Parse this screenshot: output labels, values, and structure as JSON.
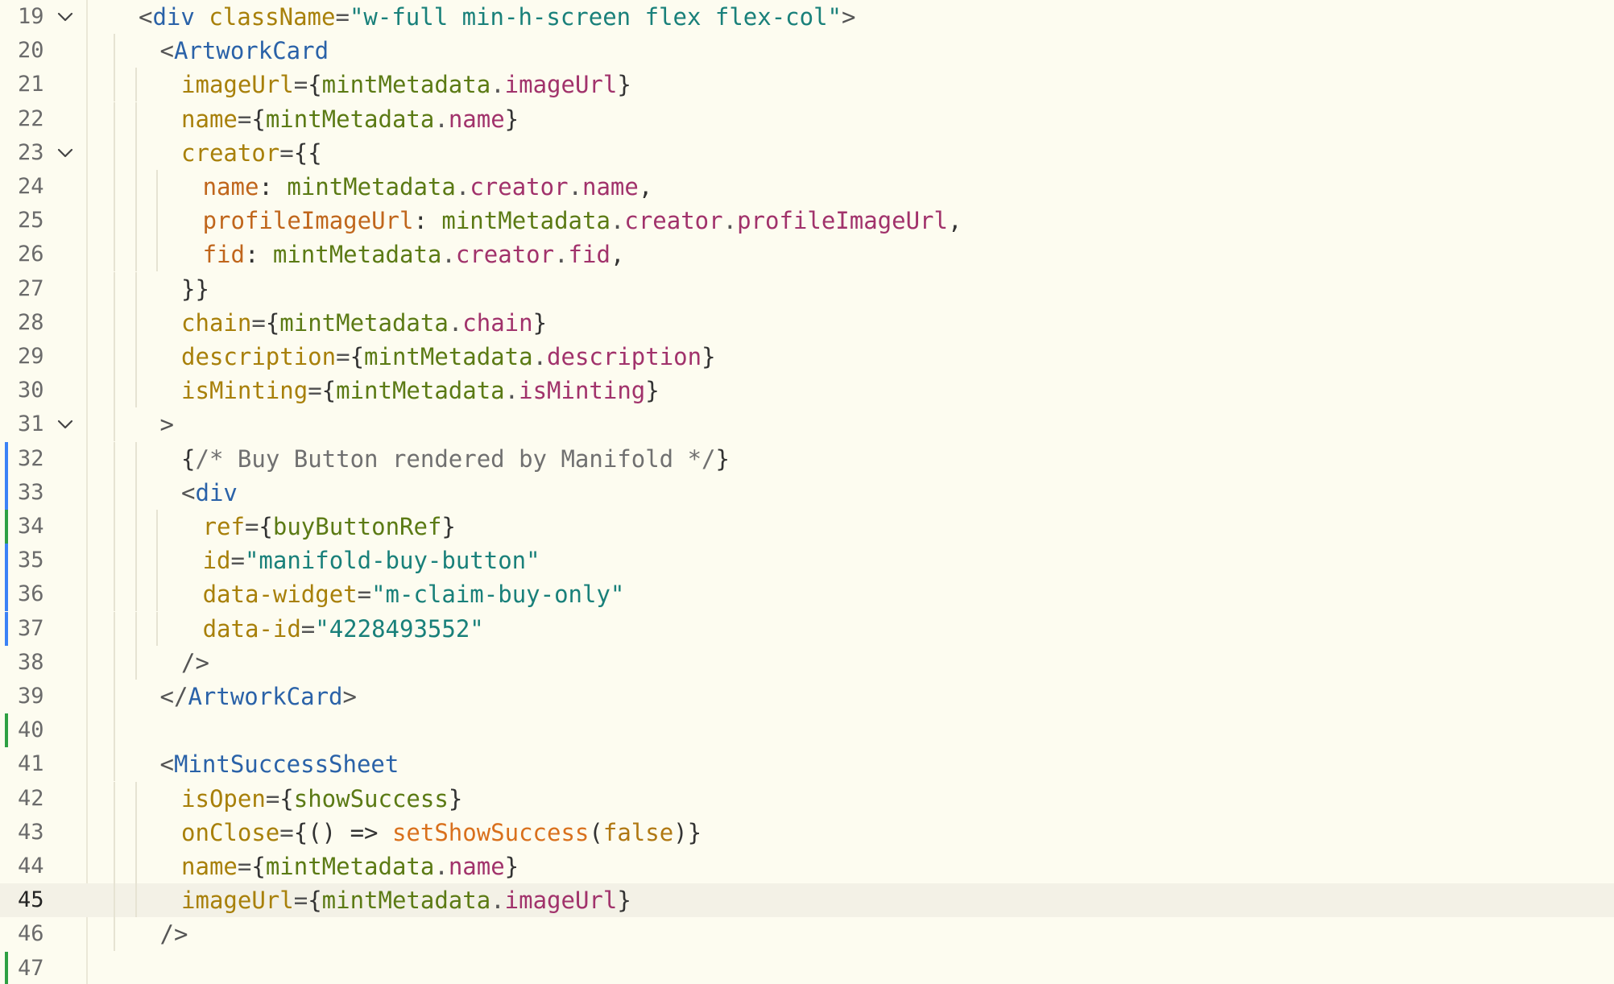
{
  "editor": {
    "current_line": "45",
    "colors": {
      "background": "#fdfcf0",
      "tag": "#2a62a8",
      "attribute": "#a8800a",
      "string": "#19807a",
      "identifier": "#5b7a14",
      "property": "#a1326b",
      "key": "#c0661c",
      "function": "#d9701c",
      "comment": "#707070",
      "diff_added": "#2ea043",
      "diff_modified": "#3b82f6"
    },
    "lines": [
      {
        "num": "19",
        "fold": true,
        "diff": "",
        "indent": 0,
        "tokens": [
          {
            "t": "<",
            "c": "punc"
          },
          {
            "t": "div",
            "c": "tag"
          },
          {
            "t": " ",
            "c": "punc"
          },
          {
            "t": "className",
            "c": "attr"
          },
          {
            "t": "=",
            "c": "punc"
          },
          {
            "t": "\"w-full min-h-screen flex flex-col\"",
            "c": "str"
          },
          {
            "t": ">",
            "c": "punc"
          }
        ]
      },
      {
        "num": "20",
        "fold": false,
        "diff": "",
        "indent": 1,
        "tokens": [
          {
            "t": "<",
            "c": "punc"
          },
          {
            "t": "ArtworkCard",
            "c": "tag"
          }
        ]
      },
      {
        "num": "21",
        "fold": false,
        "diff": "",
        "indent": 2,
        "tokens": [
          {
            "t": "imageUrl",
            "c": "attr"
          },
          {
            "t": "=",
            "c": "punc"
          },
          {
            "t": "{",
            "c": "brace"
          },
          {
            "t": "mintMetadata",
            "c": "ident"
          },
          {
            "t": ".",
            "c": "punc"
          },
          {
            "t": "imageUrl",
            "c": "prop"
          },
          {
            "t": "}",
            "c": "brace"
          }
        ]
      },
      {
        "num": "22",
        "fold": false,
        "diff": "",
        "indent": 2,
        "tokens": [
          {
            "t": "name",
            "c": "attr"
          },
          {
            "t": "=",
            "c": "punc"
          },
          {
            "t": "{",
            "c": "brace"
          },
          {
            "t": "mintMetadata",
            "c": "ident"
          },
          {
            "t": ".",
            "c": "punc"
          },
          {
            "t": "name",
            "c": "prop"
          },
          {
            "t": "}",
            "c": "brace"
          }
        ]
      },
      {
        "num": "23",
        "fold": true,
        "diff": "",
        "indent": 2,
        "tokens": [
          {
            "t": "creator",
            "c": "attr"
          },
          {
            "t": "=",
            "c": "punc"
          },
          {
            "t": "{{",
            "c": "brace"
          }
        ]
      },
      {
        "num": "24",
        "fold": false,
        "diff": "",
        "indent": 3,
        "tokens": [
          {
            "t": "name",
            "c": "key"
          },
          {
            "t": ": ",
            "c": "brace"
          },
          {
            "t": "mintMetadata",
            "c": "ident"
          },
          {
            "t": ".",
            "c": "punc"
          },
          {
            "t": "creator",
            "c": "prop"
          },
          {
            "t": ".",
            "c": "punc"
          },
          {
            "t": "name",
            "c": "prop"
          },
          {
            "t": ",",
            "c": "brace"
          }
        ]
      },
      {
        "num": "25",
        "fold": false,
        "diff": "",
        "indent": 3,
        "tokens": [
          {
            "t": "profileImageUrl",
            "c": "key"
          },
          {
            "t": ": ",
            "c": "brace"
          },
          {
            "t": "mintMetadata",
            "c": "ident"
          },
          {
            "t": ".",
            "c": "punc"
          },
          {
            "t": "creator",
            "c": "prop"
          },
          {
            "t": ".",
            "c": "punc"
          },
          {
            "t": "profileImageUrl",
            "c": "prop"
          },
          {
            "t": ",",
            "c": "brace"
          }
        ]
      },
      {
        "num": "26",
        "fold": false,
        "diff": "",
        "indent": 3,
        "tokens": [
          {
            "t": "fid",
            "c": "key"
          },
          {
            "t": ": ",
            "c": "brace"
          },
          {
            "t": "mintMetadata",
            "c": "ident"
          },
          {
            "t": ".",
            "c": "punc"
          },
          {
            "t": "creator",
            "c": "prop"
          },
          {
            "t": ".",
            "c": "punc"
          },
          {
            "t": "fid",
            "c": "prop"
          },
          {
            "t": ",",
            "c": "brace"
          }
        ]
      },
      {
        "num": "27",
        "fold": false,
        "diff": "",
        "indent": 2,
        "tokens": [
          {
            "t": "}}",
            "c": "brace"
          }
        ]
      },
      {
        "num": "28",
        "fold": false,
        "diff": "",
        "indent": 2,
        "tokens": [
          {
            "t": "chain",
            "c": "attr"
          },
          {
            "t": "=",
            "c": "punc"
          },
          {
            "t": "{",
            "c": "brace"
          },
          {
            "t": "mintMetadata",
            "c": "ident"
          },
          {
            "t": ".",
            "c": "punc"
          },
          {
            "t": "chain",
            "c": "prop"
          },
          {
            "t": "}",
            "c": "brace"
          }
        ]
      },
      {
        "num": "29",
        "fold": false,
        "diff": "",
        "indent": 2,
        "tokens": [
          {
            "t": "description",
            "c": "attr"
          },
          {
            "t": "=",
            "c": "punc"
          },
          {
            "t": "{",
            "c": "brace"
          },
          {
            "t": "mintMetadata",
            "c": "ident"
          },
          {
            "t": ".",
            "c": "punc"
          },
          {
            "t": "description",
            "c": "prop"
          },
          {
            "t": "}",
            "c": "brace"
          }
        ]
      },
      {
        "num": "30",
        "fold": false,
        "diff": "",
        "indent": 2,
        "tokens": [
          {
            "t": "isMinting",
            "c": "attr"
          },
          {
            "t": "=",
            "c": "punc"
          },
          {
            "t": "{",
            "c": "brace"
          },
          {
            "t": "mintMetadata",
            "c": "ident"
          },
          {
            "t": ".",
            "c": "punc"
          },
          {
            "t": "isMinting",
            "c": "prop"
          },
          {
            "t": "}",
            "c": "brace"
          }
        ]
      },
      {
        "num": "31",
        "fold": true,
        "diff": "",
        "indent": 1,
        "tokens": [
          {
            "t": ">",
            "c": "punc"
          }
        ]
      },
      {
        "num": "32",
        "fold": false,
        "diff": "modified",
        "indent": 2,
        "tokens": [
          {
            "t": "{",
            "c": "brace"
          },
          {
            "t": "/* Buy Button rendered by Manifold */",
            "c": "comment"
          },
          {
            "t": "}",
            "c": "brace"
          }
        ]
      },
      {
        "num": "33",
        "fold": false,
        "diff": "modified",
        "indent": 2,
        "tokens": [
          {
            "t": "<",
            "c": "punc"
          },
          {
            "t": "div",
            "c": "tag"
          }
        ]
      },
      {
        "num": "34",
        "fold": false,
        "diff": "added",
        "indent": 3,
        "tokens": [
          {
            "t": "ref",
            "c": "attr"
          },
          {
            "t": "=",
            "c": "punc"
          },
          {
            "t": "{",
            "c": "brace"
          },
          {
            "t": "buyButtonRef",
            "c": "ident"
          },
          {
            "t": "}",
            "c": "brace"
          }
        ]
      },
      {
        "num": "35",
        "fold": false,
        "diff": "modified",
        "indent": 3,
        "tokens": [
          {
            "t": "id",
            "c": "attr"
          },
          {
            "t": "=",
            "c": "punc"
          },
          {
            "t": "\"manifold-buy-button\"",
            "c": "str"
          }
        ]
      },
      {
        "num": "36",
        "fold": false,
        "diff": "modified",
        "indent": 3,
        "tokens": [
          {
            "t": "data-widget",
            "c": "attr"
          },
          {
            "t": "=",
            "c": "punc"
          },
          {
            "t": "\"m-claim-buy-only\"",
            "c": "str"
          }
        ]
      },
      {
        "num": "37",
        "fold": false,
        "diff": "modified",
        "indent": 3,
        "tokens": [
          {
            "t": "data-id",
            "c": "attr"
          },
          {
            "t": "=",
            "c": "punc"
          },
          {
            "t": "\"4228493552\"",
            "c": "str"
          }
        ]
      },
      {
        "num": "38",
        "fold": false,
        "diff": "",
        "indent": 2,
        "tokens": [
          {
            "t": "/>",
            "c": "punc"
          }
        ]
      },
      {
        "num": "39",
        "fold": false,
        "diff": "",
        "indent": 1,
        "tokens": [
          {
            "t": "</",
            "c": "punc"
          },
          {
            "t": "ArtworkCard",
            "c": "tag"
          },
          {
            "t": ">",
            "c": "punc"
          }
        ]
      },
      {
        "num": "40",
        "fold": false,
        "diff": "added",
        "indent": 1,
        "tokens": []
      },
      {
        "num": "41",
        "fold": false,
        "diff": "",
        "indent": 1,
        "tokens": [
          {
            "t": "<",
            "c": "punc"
          },
          {
            "t": "MintSuccessSheet",
            "c": "tag"
          }
        ]
      },
      {
        "num": "42",
        "fold": false,
        "diff": "",
        "indent": 2,
        "tokens": [
          {
            "t": "isOpen",
            "c": "attr"
          },
          {
            "t": "=",
            "c": "punc"
          },
          {
            "t": "{",
            "c": "brace"
          },
          {
            "t": "showSuccess",
            "c": "ident"
          },
          {
            "t": "}",
            "c": "brace"
          }
        ]
      },
      {
        "num": "43",
        "fold": false,
        "diff": "",
        "indent": 2,
        "tokens": [
          {
            "t": "onClose",
            "c": "attr"
          },
          {
            "t": "=",
            "c": "punc"
          },
          {
            "t": "{() => ",
            "c": "brace"
          },
          {
            "t": "setShowSuccess",
            "c": "fn"
          },
          {
            "t": "(",
            "c": "brace"
          },
          {
            "t": "false",
            "c": "bool"
          },
          {
            "t": ")}",
            "c": "brace"
          }
        ]
      },
      {
        "num": "44",
        "fold": false,
        "diff": "",
        "indent": 2,
        "tokens": [
          {
            "t": "name",
            "c": "attr"
          },
          {
            "t": "=",
            "c": "punc"
          },
          {
            "t": "{",
            "c": "brace"
          },
          {
            "t": "mintMetadata",
            "c": "ident"
          },
          {
            "t": ".",
            "c": "punc"
          },
          {
            "t": "name",
            "c": "prop"
          },
          {
            "t": "}",
            "c": "brace"
          }
        ]
      },
      {
        "num": "45",
        "fold": false,
        "diff": "",
        "indent": 2,
        "tokens": [
          {
            "t": "imageUrl",
            "c": "attr"
          },
          {
            "t": "=",
            "c": "punc"
          },
          {
            "t": "{",
            "c": "brace"
          },
          {
            "t": "mintMetadata",
            "c": "ident"
          },
          {
            "t": ".",
            "c": "punc"
          },
          {
            "t": "imageUrl",
            "c": "prop"
          },
          {
            "t": "}",
            "c": "brace"
          }
        ]
      },
      {
        "num": "46",
        "fold": false,
        "diff": "",
        "indent": 1,
        "tokens": [
          {
            "t": "/>",
            "c": "punc"
          }
        ]
      },
      {
        "num": "47",
        "fold": false,
        "diff": "added",
        "indent": 0,
        "tokens": []
      }
    ]
  }
}
